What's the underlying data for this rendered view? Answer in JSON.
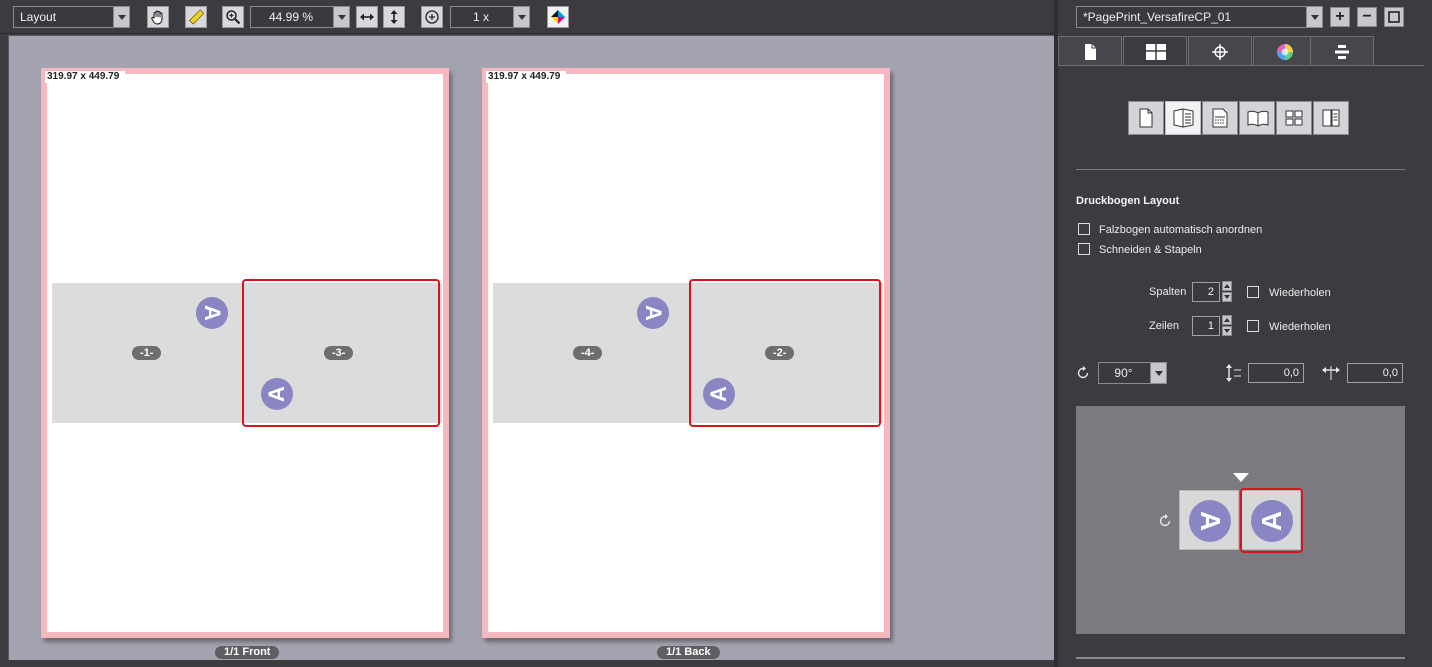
{
  "toolbar": {
    "mode_select": "Layout",
    "zoom_value": "44.99 %",
    "step_value": "1 x",
    "icons": [
      "hand-icon",
      "ruler-icon",
      "zoom-in-icon",
      "fit-width-icon",
      "fit-height-icon",
      "zoom-add-icon",
      "color-separation-icon"
    ]
  },
  "sheets": [
    {
      "size_label": "319.97 x 449.79",
      "footer": "1/1 Front",
      "pages": [
        "-1-",
        "-3-"
      ]
    },
    {
      "size_label": "319.97 x 449.79",
      "footer": "1/1 Back",
      "pages": [
        "-4-",
        "-2-"
      ]
    }
  ],
  "page_mark_letter": "A",
  "panel": {
    "job_select": "*PagePrint_VersafireCP_01",
    "add_symbol": "+",
    "remove_symbol": "−",
    "tabs": [
      "document-tab-icon",
      "layout-tab-icon",
      "marks-tab-icon",
      "color-tab-icon",
      "align-tab-icon"
    ],
    "mode_buttons": [
      "single-page-icon",
      "folding-icon",
      "booklet-stack-icon",
      "booklet-icon",
      "grid-icon",
      "imposition-icon"
    ],
    "section_title": "Druckbogen Layout",
    "checkbox_auto_arrange": "Falzbogen automatisch anordnen",
    "checkbox_cut_stack": "Schneiden & Stapeln",
    "columns_label": "Spalten",
    "columns_value": "2",
    "rows_label": "Zeilen",
    "rows_value": "1",
    "repeat_label": "Wiederholen",
    "rotation_value": "90°",
    "gap_vertical_value": "0,0",
    "gap_horizontal_value": "0,0",
    "preview_letter": "A"
  },
  "colors": {
    "accent_red": "#d8141e",
    "sheet_border": "#f6b8bf",
    "mark_purple": "#8a85c3",
    "canvas_bg": "#a4a3b0"
  }
}
